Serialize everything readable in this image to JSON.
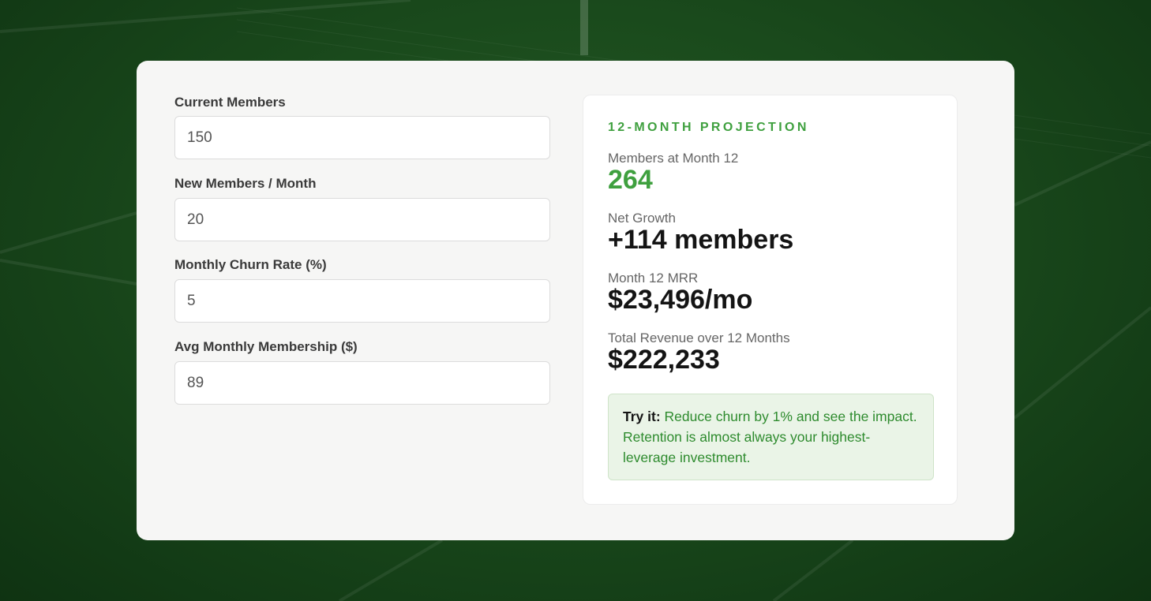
{
  "form": {
    "fields": [
      {
        "label": "Current Members",
        "value": "150"
      },
      {
        "label": "New Members / Month",
        "value": "20"
      },
      {
        "label": "Monthly Churn Rate (%)",
        "value": "5"
      },
      {
        "label": "Avg Monthly Membership ($)",
        "value": "89"
      }
    ]
  },
  "projection": {
    "title": "12-MONTH PROJECTION",
    "stats": [
      {
        "label": "Members at Month 12",
        "value": "264"
      },
      {
        "label": "Net Growth",
        "value": "+114 members"
      },
      {
        "label": "Month 12 MRR",
        "value": "$23,496/mo"
      },
      {
        "label": "Total Revenue over 12 Months",
        "value": "$222,233"
      }
    ],
    "tip": {
      "lead": "Try it:",
      "text": " Reduce churn by 1% and see the impact. Retention is almost always your highest-leverage investment."
    }
  },
  "colors": {
    "accent": "#3fa03f",
    "background": "#1a4a1c",
    "card": "#f6f6f5"
  }
}
